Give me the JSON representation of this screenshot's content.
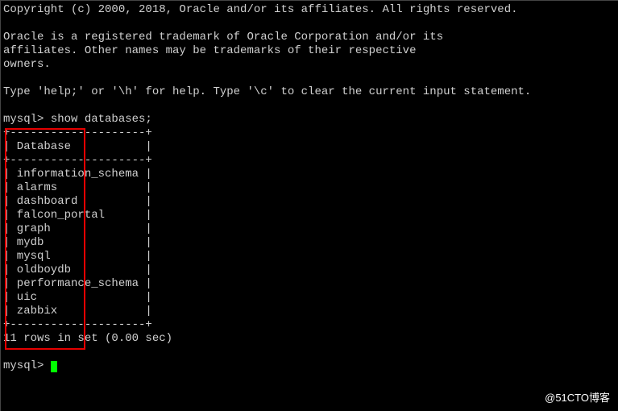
{
  "header": {
    "copyright": "Copyright (c) 2000, 2018, Oracle and/or its affiliates. All rights reserved.",
    "trademark1": "Oracle is a registered trademark of Oracle Corporation and/or its",
    "trademark2": "affiliates. Other names may be trademarks of their respective",
    "trademark3": "owners.",
    "help_hint": "Type 'help;' or '\\h' for help. Type '\\c' to clear the current input statement."
  },
  "prompt": "mysql> ",
  "command": "show databases;",
  "table": {
    "border_top": "+--------------------+",
    "header_row": "| Database           |",
    "border_mid": "+--------------------+",
    "rows": [
      "| information_schema |",
      "| alarms             |",
      "| dashboard          |",
      "| falcon_portal      |",
      "| graph              |",
      "| mydb               |",
      "| mysql              |",
      "| oldboydb           |",
      "| performance_schema |",
      "| uic                |",
      "| zabbix             |"
    ],
    "border_bot": "+--------------------+",
    "column_header": "Database",
    "databases": [
      "information_schema",
      "alarms",
      "dashboard",
      "falcon_portal",
      "graph",
      "mydb",
      "mysql",
      "oldboydb",
      "performance_schema",
      "uic",
      "zabbix"
    ]
  },
  "result_summary": "11 rows in set (0.00 sec)",
  "watermark": "@51CTO博客",
  "chart_data": {
    "type": "table",
    "title": "show databases;",
    "columns": [
      "Database"
    ],
    "rows": [
      [
        "information_schema"
      ],
      [
        "alarms"
      ],
      [
        "dashboard"
      ],
      [
        "falcon_portal"
      ],
      [
        "graph"
      ],
      [
        "mydb"
      ],
      [
        "mysql"
      ],
      [
        "oldboydb"
      ],
      [
        "performance_schema"
      ],
      [
        "uic"
      ],
      [
        "zabbix"
      ]
    ],
    "row_count": 11,
    "elapsed_sec": 0.0
  }
}
